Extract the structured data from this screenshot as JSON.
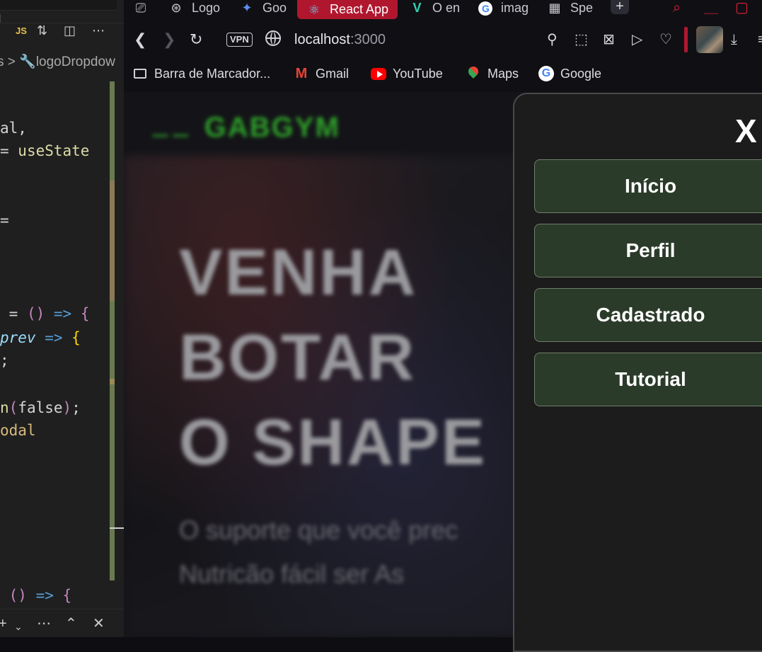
{
  "editor": {
    "breadcrumb": "s > logoDropdow",
    "code_lines": [
      {
        "parts": [
          {
            "t": "al,",
            "c": "c-w"
          }
        ]
      },
      {
        "parts": [
          {
            "t": "= ",
            "c": "c-w"
          },
          {
            "t": "useState",
            "c": "c-y"
          }
        ]
      },
      {
        "parts": [
          {
            "t": "=",
            "c": "c-w"
          }
        ]
      },
      {
        "parts": [
          {
            "t": " = ",
            "c": "c-w"
          },
          {
            "t": "()",
            "c": "c-m"
          },
          {
            "t": " => ",
            "c": "c-b"
          },
          {
            "t": "{",
            "c": "c-m"
          }
        ]
      },
      {
        "parts": [
          {
            "t": "prev",
            "c": "c-i"
          },
          {
            "t": " => ",
            "c": "c-b"
          },
          {
            "t": "{",
            "c": "c-br"
          }
        ]
      },
      {
        "parts": [
          {
            "t": ";",
            "c": "c-w"
          }
        ]
      },
      {
        "parts": [
          {
            "t": "n",
            "c": "c-y"
          },
          {
            "t": "(",
            "c": "c-m"
          },
          {
            "t": "false",
            "c": "c-w"
          },
          {
            "t": ")",
            "c": "c-m"
          },
          {
            "t": ";",
            "c": "c-w"
          }
        ]
      },
      {
        "parts": [
          {
            "t": "odal",
            "c": "c-o"
          }
        ]
      },
      {
        "parts": [
          {
            "t": " ",
            "c": "c-w"
          },
          {
            "t": "()",
            "c": "c-m"
          },
          {
            "t": " => ",
            "c": "c-b"
          },
          {
            "t": "{",
            "c": "c-m"
          }
        ]
      }
    ]
  },
  "browser": {
    "tabs": [
      {
        "label": "Logo",
        "icon": "openai-icon"
      },
      {
        "label": "Goo",
        "icon": "gemini-icon"
      },
      {
        "label": "React App",
        "icon": "react-icon",
        "active": true
      },
      {
        "label": "O en",
        "icon": "v-logo-icon"
      },
      {
        "label": "imag",
        "icon": "google-icon"
      },
      {
        "label": "Spe",
        "icon": "grid-icon"
      }
    ],
    "vpn_label": "VPN",
    "url_host": "localhost",
    "url_port": ":3000",
    "bookmarks": [
      {
        "label": "Barra de Marcador...",
        "icon": "folder-icon"
      },
      {
        "label": "Gmail",
        "icon": "gmail-icon"
      },
      {
        "label": "YouTube",
        "icon": "youtube-icon"
      },
      {
        "label": "Maps",
        "icon": "maps-icon"
      },
      {
        "label": "Google",
        "icon": "google-icon"
      }
    ]
  },
  "page": {
    "logo_text": "GABGYM",
    "hero_lines": [
      "VENHA",
      "BOTAR",
      "O SHAPE"
    ],
    "subtitle_lines": [
      "O suporte que você prec",
      "Nutricão fácil ser As"
    ]
  },
  "drawer": {
    "close_label": "X",
    "menu": [
      "Início",
      "Perfil",
      "Cadastrado",
      "Tutorial"
    ]
  },
  "colors": {
    "accent_active_tab": "#b0172f",
    "menu_button_bg": "#2b3b29",
    "drawer_bg": "#1c1c1c",
    "logo_green": "#2ea02a"
  }
}
